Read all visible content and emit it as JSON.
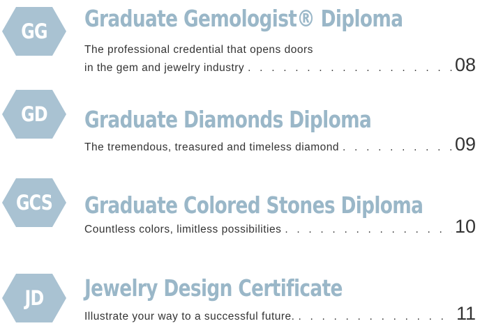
{
  "colors": {
    "hexagon_fill": "#a9c2d2",
    "title": "#9ab7c8",
    "body_text": "#333333"
  },
  "entries": [
    {
      "code": "GG",
      "title": "Graduate Gemologist® Diploma",
      "description_lines": [
        "The professional credential that opens doors",
        "in the gem and jewelry industry"
      ],
      "page": "08"
    },
    {
      "code": "GD",
      "title": "Graduate Diamonds Diploma",
      "description_lines": [
        "The tremendous, treasured and timeless diamond"
      ],
      "page": "09"
    },
    {
      "code": "GCS",
      "title": "Graduate Colored Stones Diploma",
      "description_lines": [
        "Countless colors, limitless possibilities"
      ],
      "page": "10"
    },
    {
      "code": "JD",
      "title": "Jewelry Design Certificate",
      "description_lines": [
        "Illustrate your way to a successful future."
      ],
      "page": "11"
    }
  ]
}
